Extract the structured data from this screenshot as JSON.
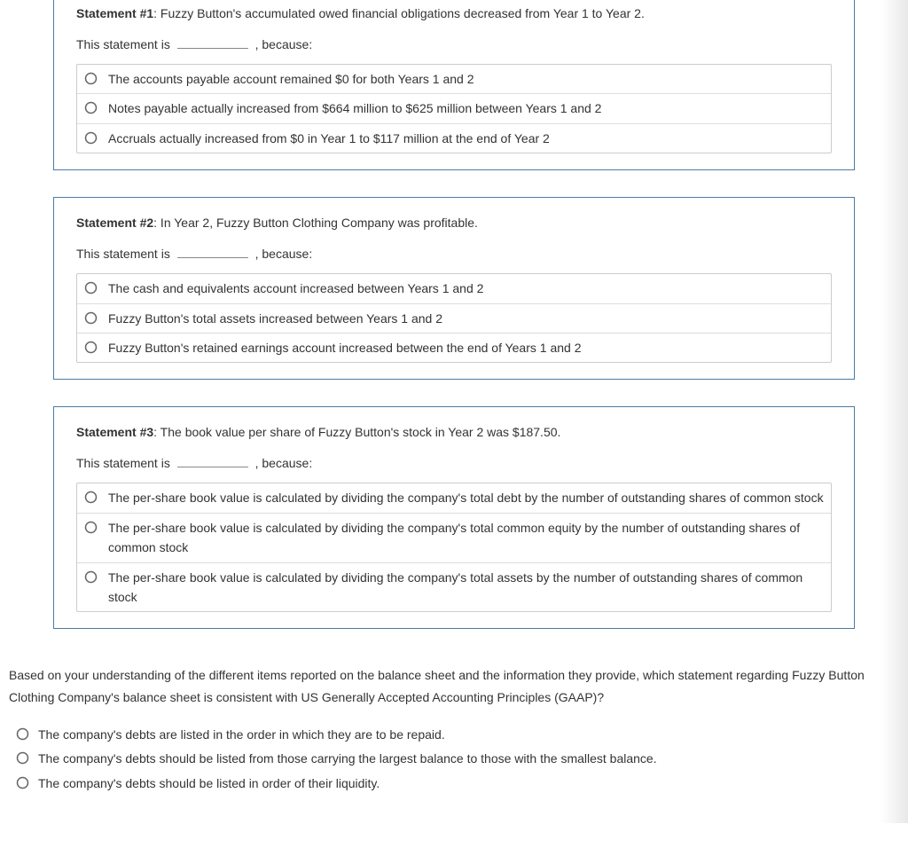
{
  "statements": [
    {
      "label": "Statement #1",
      "text": ": Fuzzy Button's accumulated owed financial obligations decreased from Year 1 to Year 2.",
      "prompt_prefix": "This statement is",
      "prompt_suffix": ", because:",
      "options": [
        "The accounts payable account remained $0 for both Years 1 and 2",
        "Notes payable actually increased from $664 million to $625 million between Years 1 and 2",
        "Accruals actually increased from $0 in Year 1 to $117 million at the end of Year 2"
      ]
    },
    {
      "label": "Statement #2",
      "text": ": In Year 2, Fuzzy Button Clothing Company was profitable.",
      "prompt_prefix": "This statement is",
      "prompt_suffix": ", because:",
      "options": [
        "The cash and equivalents account increased between Years 1 and 2",
        "Fuzzy Button's total assets increased between Years 1 and 2",
        "Fuzzy Button's retained earnings account increased between the end of Years 1 and 2"
      ]
    },
    {
      "label": "Statement #3",
      "text": ": The book value per share of Fuzzy Button's stock in Year 2 was $187.50.",
      "prompt_prefix": "This statement is",
      "prompt_suffix": ", because:",
      "options": [
        "The per-share book value is calculated by dividing the company's total debt by the number of outstanding shares of common stock",
        "The per-share book value is calculated by dividing the company's total common equity by the number of outstanding shares of common stock",
        "The per-share book value is calculated by dividing the company's total assets by the number of outstanding shares of common stock"
      ]
    }
  ],
  "bottom_question": "Based on your understanding of the different items reported on the balance sheet and the information they provide, which statement regarding Fuzzy Button Clothing Company's balance sheet is consistent with US Generally Accepted Accounting Principles (GAAP)?",
  "bottom_options": [
    "The company's debts are listed in the order in which they are to be repaid.",
    "The company's debts should be listed from those carrying the largest balance to those with the smallest balance.",
    "The company's debts should be listed in order of their liquidity."
  ]
}
